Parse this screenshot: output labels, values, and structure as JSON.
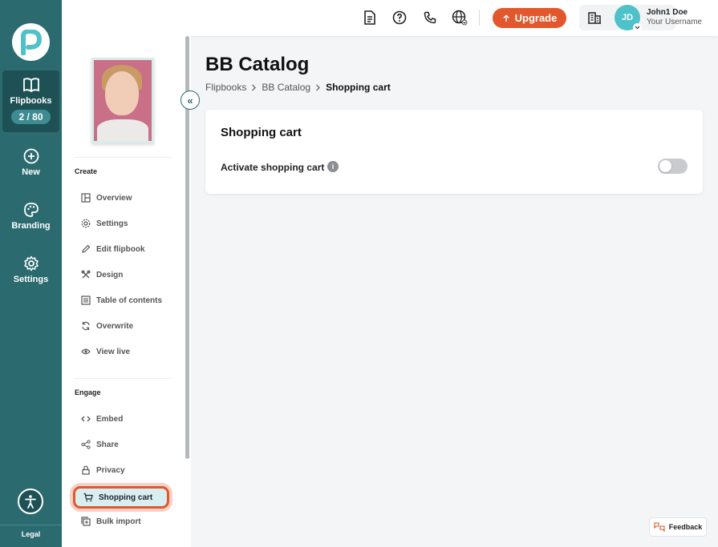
{
  "rail": {
    "logo_letter": "P",
    "flipbooks_label": "Flipbooks",
    "flipbooks_count": "2 / 80",
    "new_label": "New",
    "branding_label": "Branding",
    "settings_label": "Settings",
    "legal_label": "Legal"
  },
  "topbar": {
    "upgrade_label": "Upgrade",
    "avatar_initials": "JD",
    "user_name": "John1 Doe",
    "user_username": "Your Username"
  },
  "sidebar": {
    "create_header": "Create",
    "create_items": [
      "Overview",
      "Settings",
      "Edit flipbook",
      "Design",
      "Table of contents",
      "Overwrite",
      "View live"
    ],
    "engage_header": "Engage",
    "engage_items": [
      "Embed",
      "Share",
      "Privacy",
      "Shopping cart",
      "Bulk import"
    ],
    "active_item": "Shopping cart"
  },
  "main": {
    "title": "BB Catalog",
    "breadcrumb": [
      "Flipbooks",
      "BB Catalog",
      "Shopping cart"
    ],
    "card_title": "Shopping cart",
    "setting_label": "Activate shopping cart",
    "setting_enabled": false
  },
  "feedback_label": "Feedback",
  "colors": {
    "rail": "#2b6b70",
    "accent": "#e2572b",
    "active_bg": "#d8eef0"
  }
}
